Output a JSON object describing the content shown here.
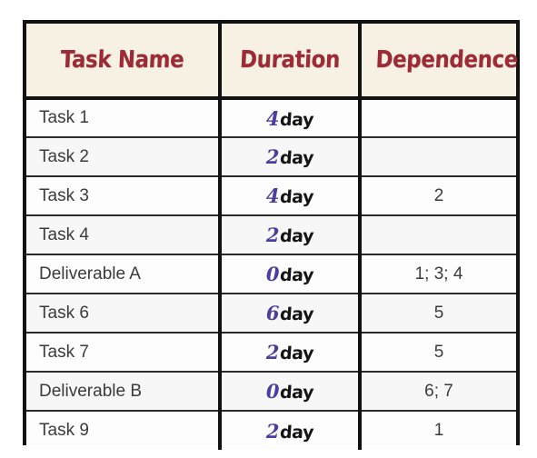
{
  "table": {
    "columns": [
      {
        "key": "task_name",
        "label": "Task Name"
      },
      {
        "key": "duration",
        "label": "Duration"
      },
      {
        "key": "dependence",
        "label": "Dependence"
      }
    ],
    "duration_unit": "day",
    "rows": [
      {
        "task_name": "Task 1",
        "duration_value": "4",
        "duration_unit": "day",
        "dependence": ""
      },
      {
        "task_name": "Task 2",
        "duration_value": "2",
        "duration_unit": "day",
        "dependence": ""
      },
      {
        "task_name": "Task 3",
        "duration_value": "4",
        "duration_unit": "day",
        "dependence": "2"
      },
      {
        "task_name": "Task 4",
        "duration_value": "2",
        "duration_unit": "day",
        "dependence": ""
      },
      {
        "task_name": "Deliverable A",
        "duration_value": "0",
        "duration_unit": "day",
        "dependence": "1; 3; 4"
      },
      {
        "task_name": "Task 6",
        "duration_value": "6",
        "duration_unit": "day",
        "dependence": "5"
      },
      {
        "task_name": "Task 7",
        "duration_value": "2",
        "duration_unit": "day",
        "dependence": "5"
      },
      {
        "task_name": "Deliverable B",
        "duration_value": "0",
        "duration_unit": "day",
        "dependence": "6; 7"
      },
      {
        "task_name": "Task 9",
        "duration_value": "2",
        "duration_unit": "day",
        "dependence": "1"
      }
    ]
  },
  "colors": {
    "header_background": "#f6f1e3",
    "header_text": "#9c2b36",
    "duration_number": "#4a3fa0",
    "duration_unit": "#141414",
    "body_text": "#3b3b3b",
    "border": "#111111",
    "page_background": "#ffffff"
  }
}
